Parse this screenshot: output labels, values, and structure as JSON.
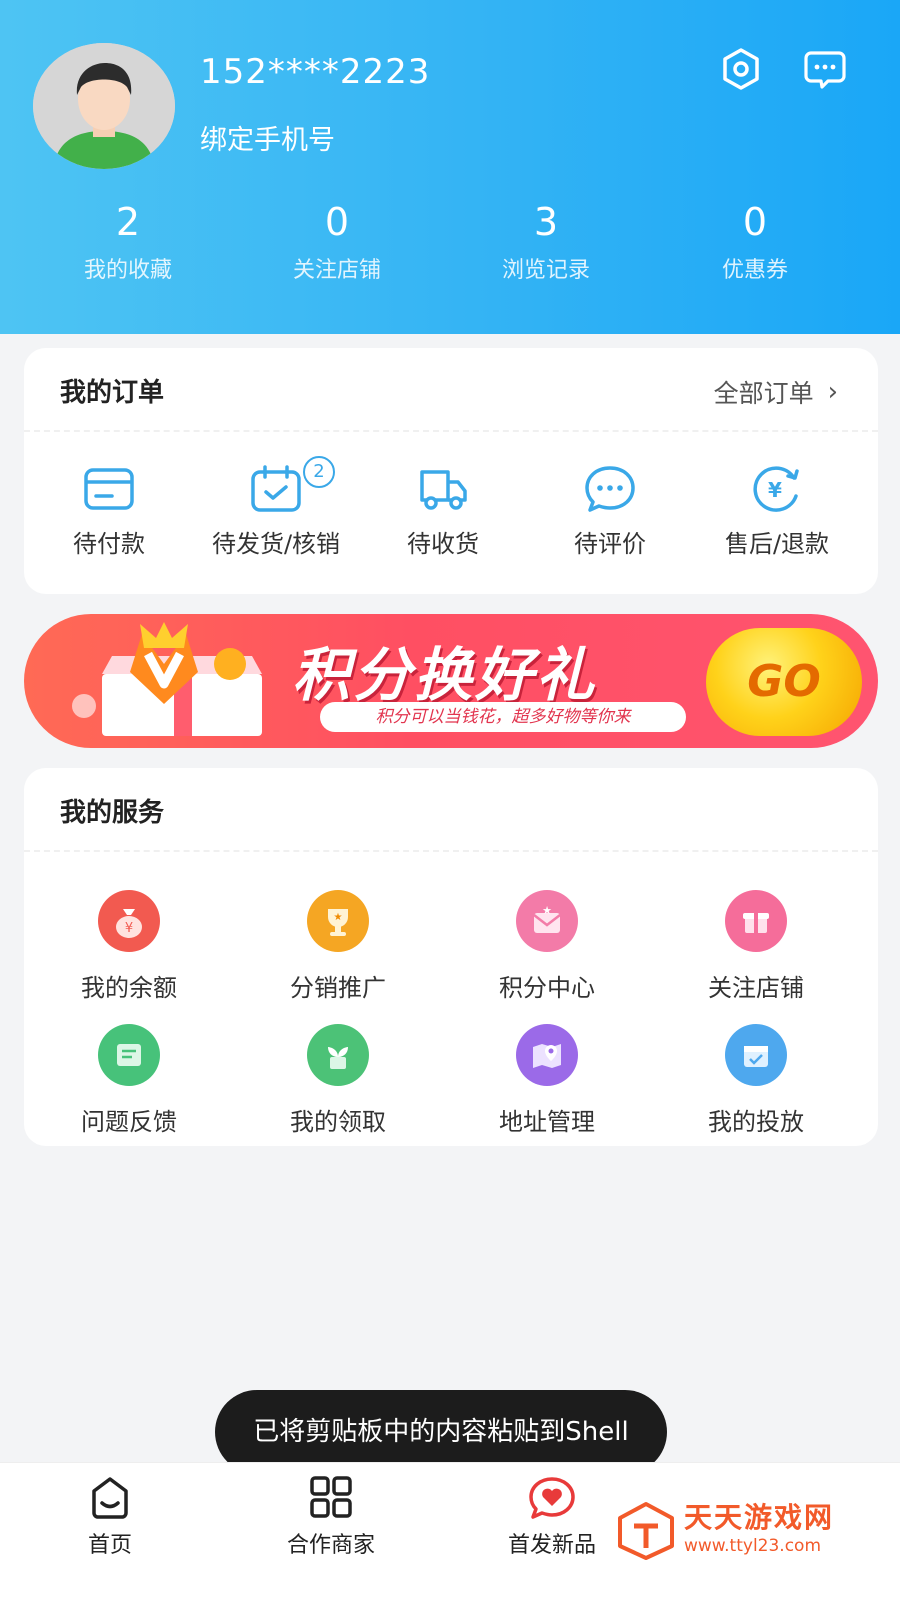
{
  "header": {
    "username": "152****2223",
    "bind_phone_label": "绑定手机号",
    "settings_icon": "settings-icon",
    "message_icon": "message-icon",
    "stats": [
      {
        "value": "2",
        "label": "我的收藏"
      },
      {
        "value": "0",
        "label": "关注店铺"
      },
      {
        "value": "3",
        "label": "浏览记录"
      },
      {
        "value": "0",
        "label": "优惠券"
      }
    ]
  },
  "orders": {
    "title": "我的订单",
    "all_label": "全部订单",
    "items": [
      {
        "label": "待付款",
        "icon": "wallet-icon"
      },
      {
        "label": "待发货/核销",
        "icon": "calendar-check-icon",
        "badge": "2"
      },
      {
        "label": "待收货",
        "icon": "truck-icon"
      },
      {
        "label": "待评价",
        "icon": "chat-icon"
      },
      {
        "label": "售后/退款",
        "icon": "refund-icon"
      }
    ]
  },
  "banner": {
    "title": "积分换好礼",
    "subtitle": "积分可以当钱花，超多好物等你来",
    "go_label": "GO"
  },
  "services": {
    "title": "我的服务",
    "items": [
      {
        "label": "我的余额",
        "icon": "money-bag-icon",
        "color": "#f25a50"
      },
      {
        "label": "分销推广",
        "icon": "trophy-icon",
        "color": "#f5a623"
      },
      {
        "label": "积分中心",
        "icon": "envelope-icon",
        "color": "#f37ba8"
      },
      {
        "label": "关注店铺",
        "icon": "gift-icon",
        "color": "#f56d9a"
      },
      {
        "label": "问题反馈",
        "icon": "feedback-icon",
        "color": "#47c27a"
      },
      {
        "label": "我的领取",
        "icon": "plant-icon",
        "color": "#4cc277"
      },
      {
        "label": "地址管理",
        "icon": "map-pin-icon",
        "color": "#9b6ae8"
      },
      {
        "label": "我的投放",
        "icon": "calendar-icon",
        "color": "#4ea8ee"
      }
    ]
  },
  "toast": {
    "text": "已将剪贴板中的内容粘贴到Shell"
  },
  "tabbar": {
    "items": [
      {
        "label": "首页",
        "icon": "home-icon"
      },
      {
        "label": "合作商家",
        "icon": "grid-icon"
      },
      {
        "label": "首发新品",
        "icon": "heart-chat-icon"
      }
    ]
  },
  "watermark": {
    "text": "天天游戏网",
    "url": "www.ttyl23.com"
  },
  "colors": {
    "primary": "#33b3f4",
    "accent": "#3aa8e8",
    "banner": "#ff5062"
  }
}
